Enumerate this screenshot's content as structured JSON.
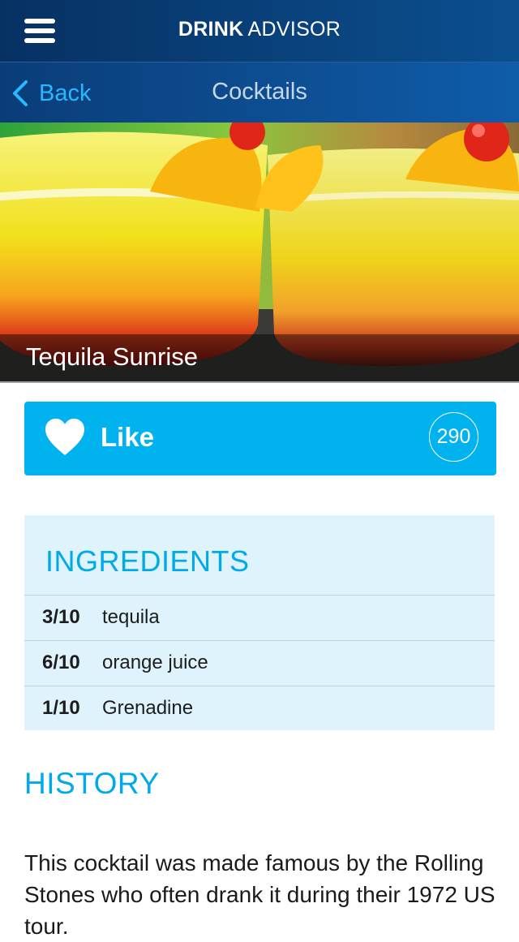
{
  "header": {
    "brand_bold": "DRINK",
    "brand_regular": "ADVISOR"
  },
  "nav": {
    "back_label": "Back",
    "title": "Cocktails"
  },
  "drink": {
    "name": "Tequila Sunrise"
  },
  "like": {
    "label": "Like",
    "count": "290"
  },
  "ingredients": {
    "title": "INGREDIENTS",
    "items": [
      {
        "amount": "3/10",
        "name": "tequila"
      },
      {
        "amount": "6/10",
        "name": "orange juice"
      },
      {
        "amount": "1/10",
        "name": "Grenadine"
      }
    ]
  },
  "history": {
    "title": "HISTORY",
    "text": "This cocktail was made famous by the Rolling Stones who often drank it during their 1972 US tour."
  },
  "colors": {
    "accent": "#00b2ee",
    "header_dark": "#073163",
    "ingredients_bg": "#def3fb"
  },
  "icons": [
    "menu-icon",
    "back-chevron-icon",
    "heart-icon"
  ]
}
